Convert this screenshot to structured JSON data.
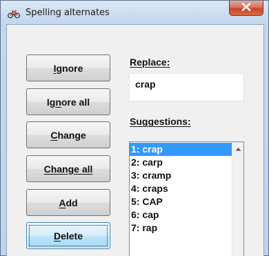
{
  "window": {
    "title": "Spelling alternates"
  },
  "buttons": [
    {
      "key": "ignore",
      "pre": "",
      "mnemonic": "I",
      "post": "gnore"
    },
    {
      "key": "ignore_all",
      "pre": "Ig",
      "mnemonic": "n",
      "post": "ore all"
    },
    {
      "key": "change",
      "pre": "",
      "mnemonic": "C",
      "post": "hange"
    },
    {
      "key": "change_all",
      "pre": "Change all",
      "mnemonic": "",
      "post": ""
    },
    {
      "key": "add",
      "pre": "",
      "mnemonic": "A",
      "post": "dd"
    },
    {
      "key": "delete",
      "pre": "",
      "mnemonic": "D",
      "post": "elete"
    }
  ],
  "replace": {
    "label": "Replace:",
    "value": "crap"
  },
  "suggestions": {
    "label": "Suggestions:",
    "selected_index": 0,
    "items": [
      "1: crap",
      "2: carp",
      "3: cramp",
      "4: craps",
      "5: CAP",
      "6: cap",
      "7: rap"
    ]
  },
  "colors": {
    "selection": "#3399ff",
    "close_button": "#c8452b",
    "focus_border": "#3c7fb1"
  },
  "icons": {
    "app": "bicycle-icon",
    "close": "close-icon",
    "scroll_up": "scroll-up-arrow-icon"
  }
}
